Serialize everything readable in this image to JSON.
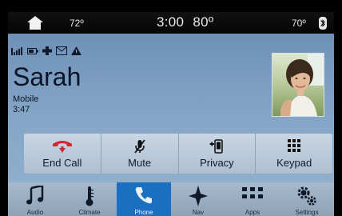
{
  "status_bar": {
    "home_icon": "home-icon",
    "left_temp": "72º",
    "clock": "3:00",
    "outside_temp": "80º",
    "right_temp": "70º",
    "bluetooth_icon": "bluetooth-icon"
  },
  "indicators": [
    "signal-strength-icon",
    "battery-icon",
    "roaming-icon",
    "message-icon",
    "alert-icon"
  ],
  "call": {
    "caller_name": "Sarah",
    "caller_type": "Mobile",
    "duration": "3:47",
    "photo": "contact-photo"
  },
  "actions": [
    {
      "label": "End Call",
      "icon": "end-call-icon",
      "color": "#d7262b"
    },
    {
      "label": "Mute",
      "icon": "mic-mute-icon"
    },
    {
      "label": "Privacy",
      "icon": "privacy-phone-icon"
    },
    {
      "label": "Keypad",
      "icon": "keypad-icon"
    }
  ],
  "nav": [
    {
      "label": "Audio",
      "icon": "music-note-icon"
    },
    {
      "label": "Climate",
      "icon": "thermometer-icon"
    },
    {
      "label": "Phone",
      "icon": "phone-icon",
      "active": true
    },
    {
      "label": "Nav",
      "icon": "compass-icon"
    },
    {
      "label": "Apps",
      "icon": "apps-grid-icon"
    },
    {
      "label": "Settings",
      "icon": "settings-gears-icon"
    }
  ],
  "colors": {
    "active_nav": "#1a6fc0",
    "end_call": "#d7262b"
  }
}
